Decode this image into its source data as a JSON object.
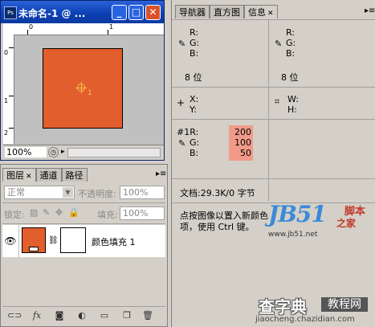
{
  "document_window": {
    "title": "未命名-1 @ ...",
    "zoom": "100%",
    "ruler_top_labels": [
      "0",
      "1"
    ],
    "ruler_left_labels": [
      "0",
      "1",
      "2"
    ],
    "colors": {
      "canvas_fill": "#e25e2c",
      "title_bar": "#0a3fb3"
    },
    "sampler_label": "1"
  },
  "layers_panel": {
    "tabs": [
      "图层",
      "通道",
      "路径"
    ],
    "blend_mode": "正常",
    "opacity_label": "不透明度:",
    "opacity_value": "100%",
    "lock_label": "锁定:",
    "fill_label": "填充:",
    "fill_value": "100%",
    "layer": {
      "name": "颜色填充 1",
      "eye": "👁"
    },
    "bottom_icons": [
      "link-icon",
      "fx-icon",
      "mask-icon",
      "adjustment-icon",
      "folder-icon",
      "new-layer-icon",
      "trash-icon"
    ]
  },
  "info_panel": {
    "tabs": [
      "导航器",
      "直方图",
      "信息"
    ],
    "top_left": {
      "r": "R:",
      "g": "G:",
      "b": "B:",
      "depth": "8 位"
    },
    "top_right": {
      "r": "R:",
      "g": "G:",
      "b": "B:",
      "depth": "8 位"
    },
    "xy": {
      "x": "X:",
      "y": "Y:"
    },
    "wh": {
      "w": "W:",
      "h": "H:"
    },
    "sampler": {
      "label_r": "#1R:",
      "label_g": "G:",
      "label_b": "B:",
      "r": "200",
      "g": "100",
      "b": "50"
    },
    "doc_size": "文档:29.3K/0 字节",
    "hint_line1": "点按图像以置入新颜色",
    "hint_line2": "项，使用 Ctrl 键。"
  },
  "watermarks": {
    "logo": "JB51",
    "logo_suffix_1": "脚本",
    "logo_suffix_2": "之家",
    "site": "www.jb51.net",
    "bottom_text": "查字典",
    "bottom_box": "教程网",
    "bottom_url": "jiaocheng.chazidian.com"
  }
}
